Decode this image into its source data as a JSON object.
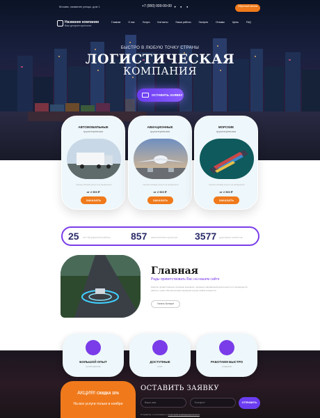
{
  "topbar": {
    "address": "Москва, название улицы, дом 1",
    "phone": "+7 (000) 000-00-00",
    "socials": [
      "telegram",
      "whatsapp",
      "vk"
    ],
    "call_button": "Обратный звонок"
  },
  "navbar": {
    "brand": "Название компании",
    "tagline": "Ваш дескриптор/слоган",
    "menu": [
      "Главная",
      "О нас",
      "Услуги",
      "Контакты",
      "Наши работы",
      "Галерея",
      "Отзывы",
      "Цены",
      "FAQ"
    ]
  },
  "hero": {
    "subtitle": "БЫСТРО В ЛЮБУЮ ТОЧКУ СТРАНЫ",
    "title": "ЛОГИСТИЧЕСКАЯ",
    "title2": "КОМПАНИЯ",
    "button": "ОСТАВИТЬ ЗАЯВКУ"
  },
  "services": [
    {
      "title": "АВТОМОБИЛЬНЫЕ",
      "subtitle": "грузоперевозки",
      "desc": "Краткое описание услуги и её преимуществ",
      "price": "от 2 500 ₽",
      "button": "ЗАКАЗАТЬ"
    },
    {
      "title": "АВИАЦИОННЫЕ",
      "subtitle": "грузоперевозки",
      "desc": "Краткое описание услуги и её преимуществ",
      "price": "от 2 500 ₽",
      "button": "ЗАКАЗАТЬ"
    },
    {
      "title": "МОРСКИЕ",
      "subtitle": "грузоперевозки",
      "desc": "Краткое описание услуги и её преимуществ",
      "price": "от 2 500 ₽",
      "button": "ЗАКАЗАТЬ"
    }
  ],
  "stats": [
    {
      "num": "25",
      "label": "лет безупречной работы"
    },
    {
      "num": "857",
      "label": "выполненных проектов"
    },
    {
      "num": "3577",
      "label": "довольных клиентов"
    }
  ],
  "about": {
    "title": "Главная",
    "subtitle": "Рады приветствовать Вас на нашем сайте",
    "text": "Краткое приветственное описание компании, основных направлений деятельности и преимуществ работы с нами. Мы выполняем перевозки грузов любой сложности.",
    "button": "Узнать больше"
  },
  "features": [
    {
      "title": "БОЛЬШОЙ ОПЫТ",
      "subtitle": "грузоперевозок",
      "icon": "box-icon"
    },
    {
      "title": "ДОСТУПНЫЕ",
      "subtitle": "цены",
      "icon": "truck-icon"
    },
    {
      "title": "РАБОТАЕМ БЫСТРО",
      "subtitle": "и надежно",
      "icon": "delivery-icon"
    }
  ],
  "promo": {
    "label": "АКЦИЯ!",
    "discount": "СКИДКА 15%",
    "text": "На все услуги только в ноябре"
  },
  "form": {
    "title": "ОСТАВИТЬ ЗАЯВКУ",
    "name_placeholder": "Ваше имя",
    "phone_placeholder": "Телефон*",
    "button": "ОТПРАВИТЬ",
    "consent": "Отправляя, я соглашаюсь с",
    "consent_link": "политикой конфиденциальности"
  },
  "colors": {
    "accent": "#7a3ce8",
    "orange": "#f07a1b",
    "dark": "#1b1620"
  }
}
